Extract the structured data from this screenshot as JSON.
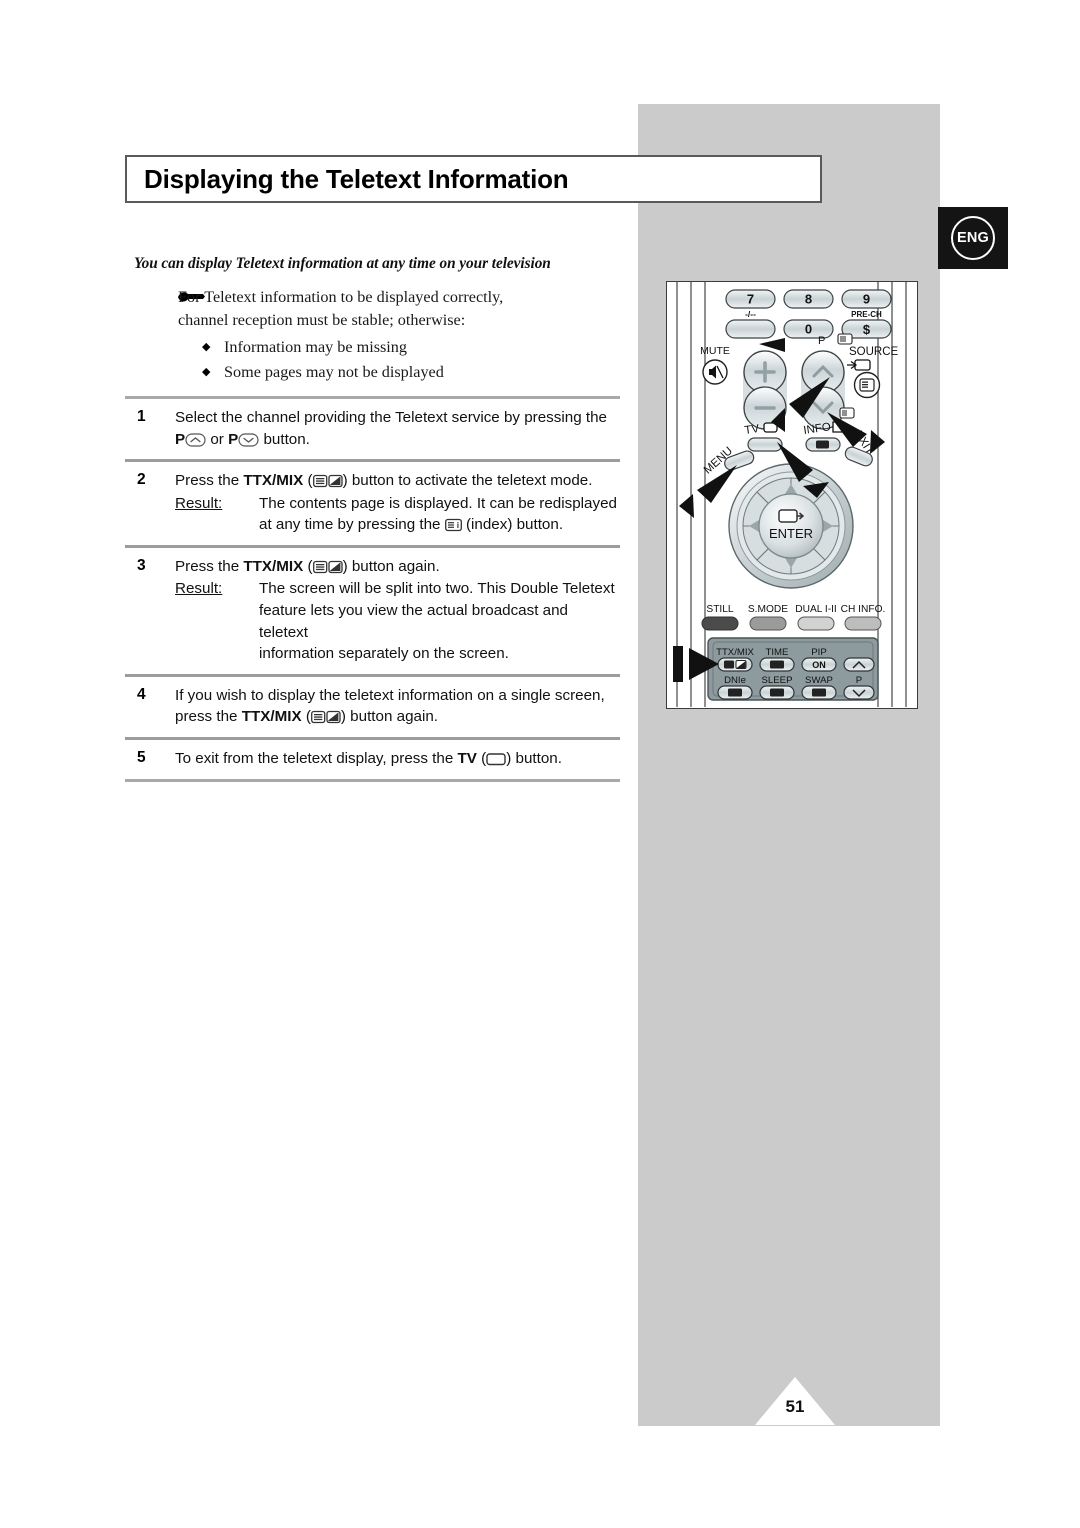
{
  "document": {
    "title": "Displaying the Teletext Information",
    "language_badge": "ENG",
    "page_number": "51"
  },
  "intro": {
    "text": "You can display Teletext information at any time on your television"
  },
  "note": {
    "icon": "pointing-hand-icon",
    "line1": "For Teletext information to be displayed correctly,",
    "line2": "channel reception must be stable; otherwise:",
    "bullets": [
      "Information may be missing",
      "Some pages may not be displayed"
    ]
  },
  "steps": [
    {
      "number": "1",
      "text_before": "Select the channel providing the Teletext service by pressing the",
      "line2_pre": "",
      "bold1": "P",
      "icon1": "p-up-icon",
      "mid": " or ",
      "bold2": "P",
      "icon2": "p-down-icon",
      "tail": " button."
    },
    {
      "number": "2",
      "pre": "Press the ",
      "bold": "TTX/MIX",
      "icon": "ttx-mix-icon",
      "post": " button to activate the teletext mode.",
      "result_label": "Result:",
      "result_line1": "The contents page is displayed. It can be redisplayed",
      "result_line2_pre": "at any time by pressing the ",
      "result_icon": "index-icon",
      "result_line2_post": " (index) button."
    },
    {
      "number": "3",
      "pre": "Press the ",
      "bold": "TTX/MIX",
      "icon": "ttx-mix-icon",
      "post": " button again.",
      "result_label": "Result:",
      "result_line1": "The screen will be split into two. This Double Teletext",
      "result_line2": "feature lets you view the actual broadcast and teletext",
      "result_line3": "information separately on the screen."
    },
    {
      "number": "4",
      "line1": "If you wish to display the teletext information on a single screen,",
      "line2_pre": "press the ",
      "bold": "TTX/MIX",
      "icon": "ttx-mix-icon",
      "line2_post": " button again."
    },
    {
      "number": "5",
      "pre": "To exit from the teletext display, press the ",
      "bold": "TV",
      "icon": "tv-screen-icon",
      "post": " button."
    }
  ],
  "remote": {
    "name": "tv-remote-control-diagram",
    "numeric_keys": [
      "7",
      "8",
      "9"
    ],
    "numeric_sublabels": [
      "-/--",
      "",
      "PRE-CH"
    ],
    "zero_key": "0",
    "labels": {
      "mute": "MUTE",
      "volume_p": "P",
      "source": "SOURCE",
      "tv": "TV",
      "info": "INFO",
      "menu": "MENU",
      "exit": "EXIT",
      "enter": "ENTER"
    },
    "feature_row": [
      "STILL",
      "S.MODE",
      "DUAL I-II",
      "CH INFO."
    ],
    "teletext_pad": {
      "row1": [
        "TTX/MIX",
        "TIME",
        "PIP",
        ""
      ],
      "row1_button_labels": [
        "",
        "",
        "ON",
        ""
      ],
      "row2": [
        "DNIe",
        "SLEEP",
        "SWAP",
        "P"
      ]
    },
    "callout_targets": [
      "p-up-button",
      "p-down-button",
      "menu-button",
      "tv-button",
      "ttx-mix-button"
    ]
  },
  "colors": {
    "band_grey": "#cbcbcb",
    "badge_black": "#141414",
    "rule_grey": "#a9a9a9",
    "button_grey": "#b9c0c2"
  }
}
